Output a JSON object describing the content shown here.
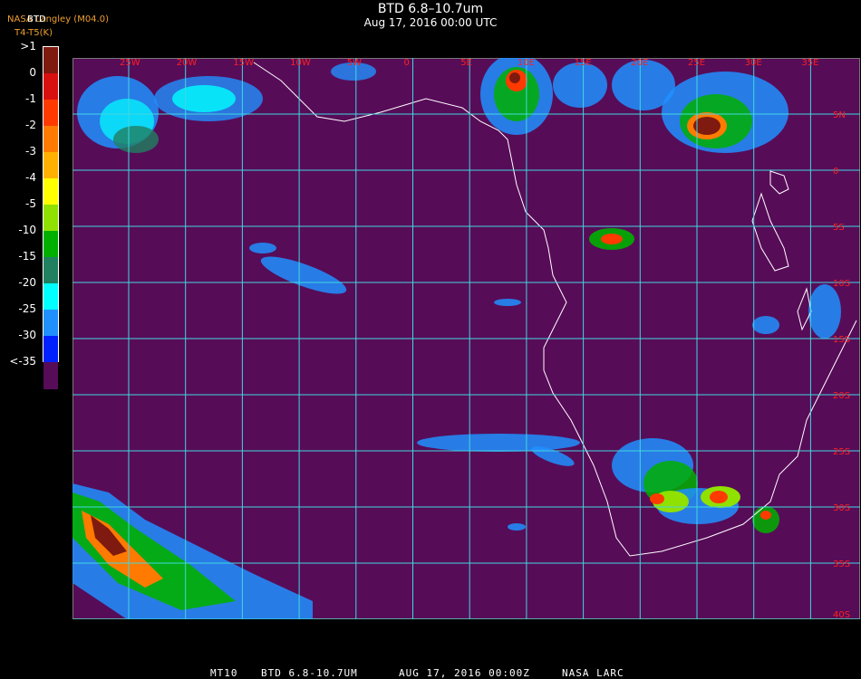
{
  "header": {
    "title": "BTD 6.8–10.7um",
    "subtitle": "Aug 17, 2016 00:00 UTC",
    "credit_line1": "NASA Langley (M04.0)",
    "credit_line2": "T4-T5(K)",
    "credit_overlap": "BTD"
  },
  "legend": {
    "labels": [
      ">1",
      "0",
      "-1",
      "-2",
      "-3",
      "-4",
      "-5",
      "-10",
      "-15",
      "-20",
      "-25",
      "-30",
      "<-35"
    ],
    "colors": [
      "#7f1a10",
      "#d81010",
      "#ff3a00",
      "#ff7a00",
      "#ffb000",
      "#ffff00",
      "#90e000",
      "#00b000",
      "#208060",
      "#00ffff",
      "#2090ff",
      "#0020ff",
      "#570c58"
    ]
  },
  "map": {
    "background_color": "#570c58",
    "grid_color": "#40d8e0",
    "lon_labels": [
      "25W",
      "20W",
      "15W",
      "10W",
      "5W",
      "0",
      "5E",
      "10E",
      "15E",
      "20E",
      "25E",
      "30E",
      "35E"
    ],
    "lat_labels": [
      "5N",
      "0",
      "5S",
      "10S",
      "15S",
      "20S",
      "25S",
      "30S",
      "35S",
      "40S"
    ],
    "label_color": "#ff2020"
  },
  "footer": {
    "f1": "MT10",
    "f2": "BTD 6.8-10.7UM",
    "f3": "AUG 17, 2016 00:00Z",
    "f4": "NASA LARC"
  }
}
